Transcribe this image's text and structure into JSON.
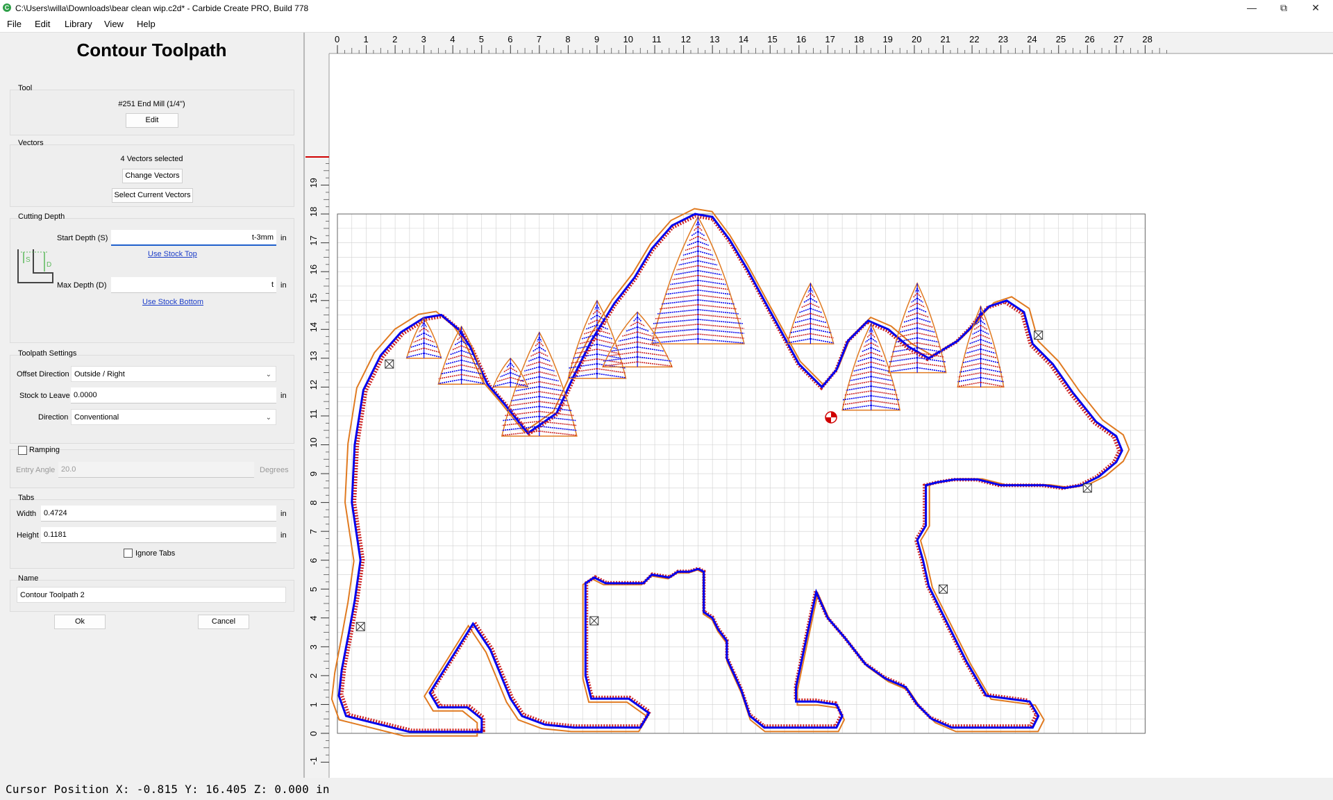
{
  "window": {
    "title": "C:\\Users\\willa\\Downloads\\bear clean wip.c2d* - Carbide Create PRO, Build 778",
    "app_icon": "carbide-create-icon",
    "controls": [
      "minimize-icon",
      "restore-icon",
      "close-icon"
    ]
  },
  "menu": {
    "file": "File",
    "edit": "Edit",
    "library": "Library",
    "view": "View",
    "help": "Help"
  },
  "panel": {
    "title": "Contour Toolpath",
    "tool": {
      "label": "Tool",
      "name": "#251 End Mill (1/4\")",
      "edit_label": "Edit"
    },
    "vectors": {
      "label": "Vectors",
      "status": "4 Vectors selected",
      "change_label": "Change Vectors",
      "select_label": "Select Current Vectors"
    },
    "cutting_depth": {
      "label": "Cutting Depth",
      "start_label": "Start Depth (S)",
      "start_value": "t-3mm",
      "start_unit": "in",
      "use_stock_top": "Use Stock Top",
      "max_label": "Max Depth (D)",
      "max_value": "t",
      "max_unit": "in",
      "use_stock_bottom": "Use Stock Bottom",
      "diagram_s": "S",
      "diagram_d": "D"
    },
    "toolpath_settings": {
      "label": "Toolpath Settings",
      "offset_label": "Offset Direction",
      "offset_value": "Outside / Right",
      "stock_label": "Stock to Leave",
      "stock_value": "0.0000",
      "stock_unit": "in",
      "direction_label": "Direction",
      "direction_value": "Conventional"
    },
    "ramping": {
      "label": "Ramping",
      "checked": false,
      "entry_label": "Entry Angle",
      "entry_value": "20.0",
      "entry_unit": "Degrees"
    },
    "tabs": {
      "label": "Tabs",
      "width_label": "Width",
      "width_value": "0.4724",
      "width_unit": "in",
      "height_label": "Height",
      "height_value": "0.1181",
      "height_unit": "in",
      "ignore_label": "Ignore Tabs",
      "ignore_checked": false
    },
    "name": {
      "label": "Name",
      "value": "Contour Toolpath 2"
    },
    "ok_label": "Ok",
    "cancel_label": "Cancel"
  },
  "canvas": {
    "x_ticks": [
      "0",
      "1",
      "2",
      "3",
      "4",
      "5",
      "6",
      "7",
      "8",
      "9",
      "10",
      "11",
      "12",
      "13",
      "14",
      "15",
      "16",
      "17",
      "18",
      "19",
      "20",
      "21",
      "22",
      "23",
      "24",
      "25",
      "26",
      "27",
      "28"
    ],
    "y_ticks": [
      "-1",
      "0",
      "1",
      "2",
      "3",
      "4",
      "5",
      "6",
      "7",
      "8",
      "9",
      "10",
      "11",
      "12",
      "13",
      "14",
      "15",
      "16",
      "17",
      "18",
      "19"
    ],
    "stock_width": 28,
    "stock_height": 18,
    "colors": {
      "vector": "#0000ee",
      "offset": "#e07a20",
      "toolpath_red": "#cc2222",
      "grid": "#cfcfcf",
      "ruler_mark": "#d00000"
    }
  },
  "status": {
    "cursor_text": "Cursor Position X: -0.815 Y: 16.405 Z: 0.000 in"
  }
}
